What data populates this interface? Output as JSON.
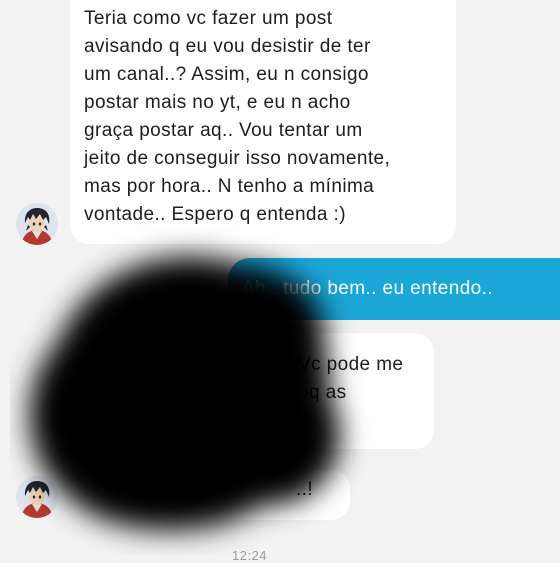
{
  "conversation": {
    "messages": [
      {
        "sender": "contact",
        "lines": [
          "Teria como vc fazer um post",
          "avisando q eu vou desistir de ter",
          "um canal..? Assim, eu n consigo",
          "postar mais no yt, e eu n acho",
          "graça postar aq.. Vou tentar um",
          "jeito de conseguir isso novamente,",
          "mas por hora.. N tenho a mínima",
          "vontade.. Espero q entenda :)"
        ]
      },
      {
        "sender": "me",
        "text": "Ah.. tudo bem.. eu entendo.."
      },
      {
        "sender": "contact",
        "lines": [
          "Vc pode me",
          "oq as"
        ]
      },
      {
        "sender": "contact",
        "text": "..!"
      }
    ],
    "timestamp": "12:24"
  },
  "avatars": {
    "contact_icon": "anime-character-avatar-icon"
  },
  "overlay": {
    "type": "black-blur-censor",
    "color": "#000000"
  },
  "colors": {
    "background": "#f2f2f2",
    "incoming_bubble": "#ffffff",
    "outgoing_bubble": "#1ba6d8",
    "incoming_text": "#1d1d1d",
    "outgoing_text": "#ffffff"
  }
}
